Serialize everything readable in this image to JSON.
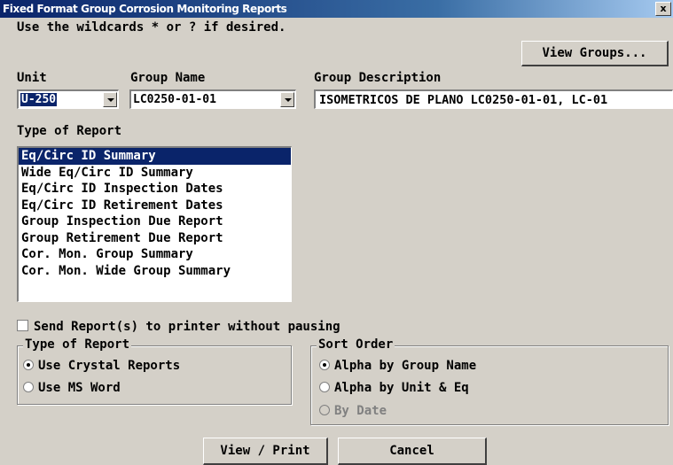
{
  "window": {
    "title": "Fixed Format Group Corrosion Monitoring Reports",
    "close_glyph": "x"
  },
  "hint": "Use the wildcards * or ? if desired.",
  "buttons": {
    "view_groups": "View Groups...",
    "view_print": "View / Print",
    "cancel": "Cancel"
  },
  "fields": {
    "unit": {
      "label": "Unit",
      "value": "U-250"
    },
    "group_name": {
      "label": "Group Name",
      "value": "LC0250-01-01"
    },
    "group_description": {
      "label": "Group Description",
      "value": "ISOMETRICOS DE PLANO LC0250-01-01, LC-01"
    }
  },
  "report_list": {
    "label": "Type of Report",
    "selected_index": 0,
    "items": [
      "Eq/Circ ID Summary",
      "Wide Eq/Circ ID Summary",
      "Eq/Circ ID Inspection Dates",
      "Eq/Circ ID Retirement Dates",
      "Group Inspection Due Report",
      "Group Retirement Due Report",
      "Cor. Mon. Group Summary",
      "Cor. Mon. Wide Group Summary"
    ]
  },
  "send_to_printer": {
    "label": "Send Report(s) to printer without pausing",
    "checked": false
  },
  "report_format": {
    "legend": "Type of Report",
    "options": [
      {
        "label": "Use Crystal Reports",
        "selected": true
      },
      {
        "label": "Use MS Word",
        "selected": false
      }
    ]
  },
  "sort_order": {
    "legend": "Sort Order",
    "options": [
      {
        "label": "Alpha by Group Name",
        "selected": true,
        "enabled": true
      },
      {
        "label": "Alpha by Unit & Eq",
        "selected": false,
        "enabled": true
      },
      {
        "label": "By Date",
        "selected": false,
        "enabled": false
      }
    ]
  },
  "colors": {
    "selection": "#0a246a",
    "face": "#d4d0c8",
    "disabled_text": "#808080"
  }
}
